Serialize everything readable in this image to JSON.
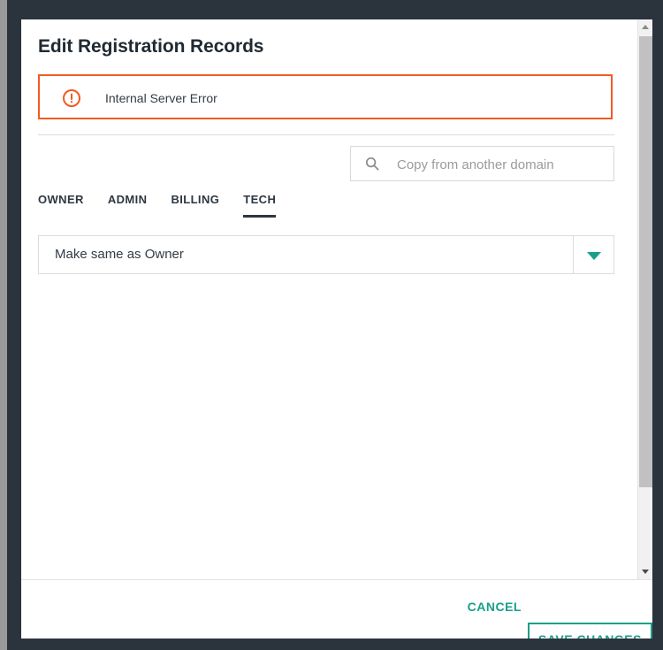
{
  "window": {
    "frame_color": "#2b333d",
    "modal_background": "#ffffff"
  },
  "dialog": {
    "title": "Edit Registration Records"
  },
  "alert": {
    "message": "Internal Server Error",
    "icon": "error-exclamation-circle-icon",
    "border_color": "#f15a22",
    "icon_color": "#f15a22"
  },
  "search": {
    "placeholder": "Copy from another domain",
    "value": "",
    "icon": "search-icon"
  },
  "tabs": [
    {
      "label": "OWNER",
      "active": false
    },
    {
      "label": "ADMIN",
      "active": false
    },
    {
      "label": "BILLING",
      "active": false
    },
    {
      "label": "TECH",
      "active": true
    }
  ],
  "contact_select": {
    "value": "Make same as Owner",
    "arrow_icon": "chevron-down-icon",
    "arrow_color": "#17a089"
  },
  "footer": {
    "cancel_label": "CANCEL",
    "save_label": "SAVE CHANGES",
    "accent_color": "#17a089"
  },
  "scrollbar": {
    "up_icon": "scroll-up-arrow-icon",
    "down_icon": "scroll-down-arrow-icon"
  }
}
